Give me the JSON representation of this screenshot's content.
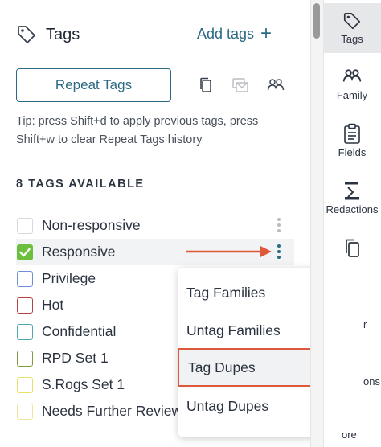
{
  "header": {
    "title": "Tags",
    "add_tags_label": "Add tags",
    "add_icon": "plus-icon"
  },
  "toolbar": {
    "repeat_tags_label": "Repeat Tags"
  },
  "tip": "Tip: press Shift+d to apply previous tags, press Shift+w to clear Repeat Tags history",
  "available_label": "8 TAGS AVAILABLE",
  "tags": [
    {
      "label": "Non-responsive",
      "color": "#d6d9dd",
      "checked": false
    },
    {
      "label": "Responsive",
      "color": "#6cbf3c",
      "checked": true
    },
    {
      "label": "Privilege",
      "color": "#6f8fd8",
      "checked": false
    },
    {
      "label": "Hot",
      "color": "#b84040",
      "checked": false
    },
    {
      "label": "Confidential",
      "color": "#4fa8b0",
      "checked": false
    },
    {
      "label": "RPD Set 1",
      "color": "#7c9a3e",
      "checked": false
    },
    {
      "label": "S.Rogs Set 1",
      "color": "#e9e06a",
      "checked": false
    },
    {
      "label": "Needs Further Review",
      "color": "#f0e59a",
      "checked": false
    }
  ],
  "menu": {
    "items": [
      "Tag Families",
      "Untag Families",
      "Tag Dupes",
      "Untag Dupes"
    ],
    "highlighted": "Tag Dupes",
    "highlight_color": "#e0583a"
  },
  "annotation_arrow_color": "#e0583a",
  "sidebar": {
    "items": [
      {
        "label": "Tags",
        "icon": "tag-icon",
        "active": true
      },
      {
        "label": "Family",
        "icon": "family-icon"
      },
      {
        "label": "Fields",
        "icon": "clipboard-icon"
      },
      {
        "label": "Redactions",
        "icon": "redaction-icon"
      },
      {
        "label": "",
        "icon": "duplicate-icon"
      }
    ],
    "partial_labels": [
      "r",
      "ons",
      "ore"
    ]
  }
}
